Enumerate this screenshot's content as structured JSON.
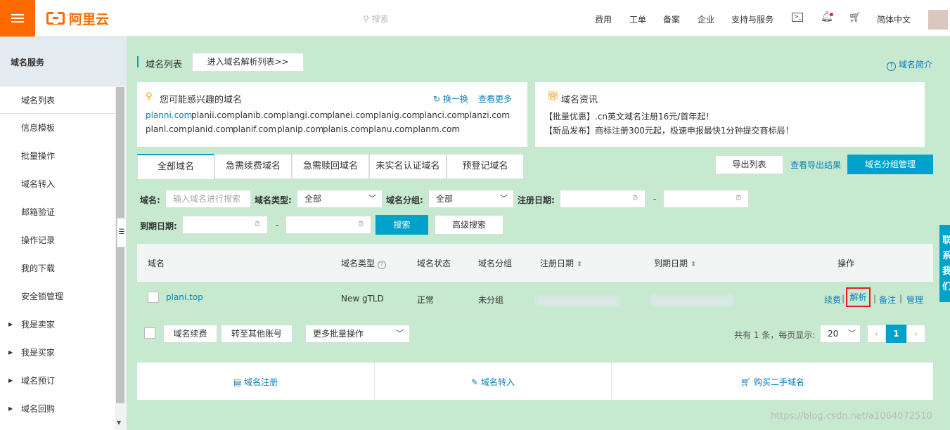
{
  "topbar": {
    "search_placeholder": "搜索",
    "nav": [
      "费用",
      "工单",
      "备案",
      "企业",
      "支持与服务"
    ],
    "language": "简体中文",
    "logo_text": "阿里云",
    "accent": "#ff6a00"
  },
  "sidebar": {
    "title": "域名服务",
    "items": [
      "域名列表",
      "信息模板",
      "批量操作",
      "域名转入",
      "邮箱验证",
      "操作记录",
      "我的下载",
      "安全锁管理"
    ],
    "expandable": [
      "我是卖家",
      "我是买家",
      "域名预订",
      "域名回购"
    ]
  },
  "header": {
    "title": "域名列表",
    "dns_list_button": "进入域名解析列表>>",
    "intro_link": "域名简介"
  },
  "suggest": {
    "title": "您可能感兴趣的域名",
    "refresh": "换一换",
    "more": "查看更多",
    "row1": [
      "planni.com",
      "planii.com",
      "planib.com",
      "plangi.com",
      "planei.com",
      "planig.com",
      "planci.com",
      "planzi.com"
    ],
    "row2": [
      "planl.com",
      "planid.com",
      "planif.com",
      "planip.com",
      "planis.com",
      "planu.com",
      "planm.com"
    ]
  },
  "news": {
    "title": "域名资讯",
    "items": [
      "【批量优惠】.cn英文域名注册16元/首年起！",
      "【新品发布】商标注册300元起，极速申报最快1分钟提交商标局！"
    ]
  },
  "tabs": [
    "全部域名",
    "急需续费域名",
    "急需赎回域名",
    "未实名认证域名",
    "预登记域名"
  ],
  "actions": {
    "export": "导出列表",
    "view_export": "查看导出结果",
    "group_manage": "域名分组管理"
  },
  "filters": {
    "domain_label": "域名:",
    "domain_placeholder": "输入域名进行搜索",
    "type_label": "域名类型:",
    "type_value": "全部",
    "group_label": "域名分组:",
    "group_value": "全部",
    "reg_date_label": "注册日期:",
    "exp_date_label": "到期日期:",
    "dash": "-",
    "search_btn": "搜索",
    "advanced_btn": "高级搜索"
  },
  "table": {
    "headers": [
      "域名",
      "域名类型",
      "域名状态",
      "域名分组",
      "注册日期",
      "到期日期",
      "操作"
    ],
    "rows": [
      {
        "domain": "plani.top",
        "type": "New gTLD",
        "status": "正常",
        "group": "未分组",
        "ops": [
          "续费",
          "解析",
          "备注",
          "管理"
        ]
      }
    ]
  },
  "bulk": {
    "renew": "域名续费",
    "transfer": "转至其他账号",
    "more": "更多批量操作",
    "summary": "共有 1 条，每页显示:",
    "page_size": "20",
    "current_page": "1",
    "prev": "‹",
    "next": "›"
  },
  "bottom_links": [
    "域名注册",
    "域名转入",
    "购买二手域名"
  ],
  "right_float": "联系我们",
  "watermark": "https://blog.csdn.net/a1064072510"
}
